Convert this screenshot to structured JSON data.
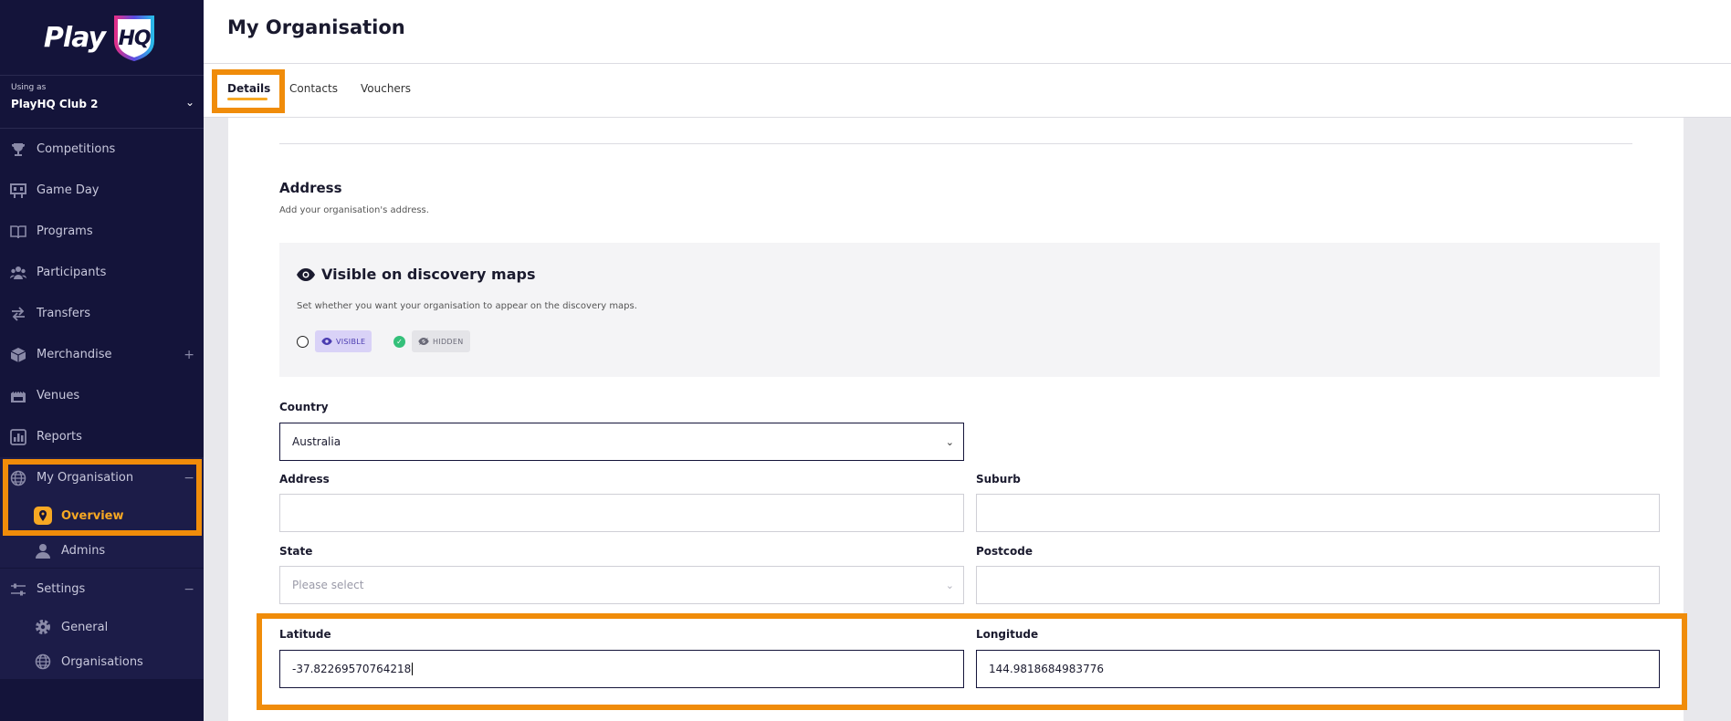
{
  "brand": {
    "logo_text": "Play",
    "logo_hq": "HQ",
    "accent": "#f7a823",
    "highlight": "#f08c0a",
    "sidebar_bg": "#14143a"
  },
  "org_switcher": {
    "label": "Using as",
    "club": "PlayHQ Club 2"
  },
  "sidebar": {
    "items": [
      {
        "label": "Competitions",
        "icon": "trophy-icon"
      },
      {
        "label": "Game Day",
        "icon": "scoreboard-icon"
      },
      {
        "label": "Programs",
        "icon": "book-icon"
      },
      {
        "label": "Participants",
        "icon": "people-icon"
      },
      {
        "label": "Transfers",
        "icon": "arrows-icon"
      },
      {
        "label": "Merchandise",
        "icon": "box-icon",
        "expand": "+"
      },
      {
        "label": "Venues",
        "icon": "stadium-icon"
      },
      {
        "label": "Reports",
        "icon": "report-icon"
      }
    ],
    "my_org": {
      "label": "My Organisation",
      "collapse": "−",
      "children": [
        "Overview",
        "Admins"
      ]
    },
    "settings": {
      "label": "Settings",
      "collapse": "−",
      "children": [
        "General",
        "Organisations"
      ]
    }
  },
  "header": {
    "title": "My Organisation"
  },
  "tabs": [
    "Details",
    "Contacts",
    "Vouchers"
  ],
  "address_section": {
    "title": "Address",
    "subtitle": "Add your organisation's address.",
    "discovery": {
      "title": "Visible on discovery maps",
      "subtitle": "Set whether you want your organisation to appear on the discovery maps.",
      "visible_label": "VISIBLE",
      "hidden_label": "HIDDEN",
      "selected": "HIDDEN"
    }
  },
  "form": {
    "country": {
      "label": "Country",
      "value": "Australia"
    },
    "address": {
      "label": "Address",
      "value": ""
    },
    "suburb": {
      "label": "Suburb",
      "value": ""
    },
    "state": {
      "label": "State",
      "placeholder": "Please select"
    },
    "postcode": {
      "label": "Postcode",
      "value": ""
    },
    "latitude": {
      "label": "Latitude",
      "value": "-37.82269570764218"
    },
    "longitude": {
      "label": "Longitude",
      "value": "144.9818684983776"
    }
  }
}
